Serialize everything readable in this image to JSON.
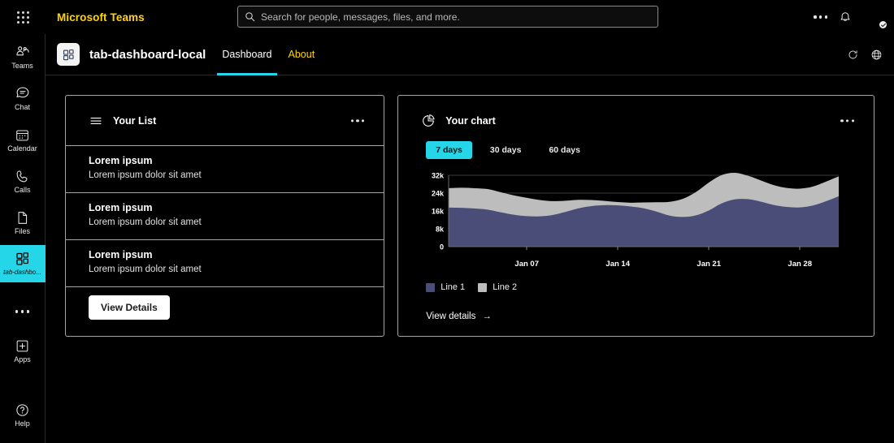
{
  "topbar": {
    "waffle_name": "app-launcher",
    "brand": "Microsoft Teams",
    "search_placeholder": "Search for people, messages, files, and more.",
    "more_label": "...",
    "bell_label": "Notifications"
  },
  "rail": {
    "items": [
      {
        "label": "Teams",
        "icon": "teams-icon",
        "active": false
      },
      {
        "label": "Chat",
        "icon": "chat-icon",
        "active": false
      },
      {
        "label": "Calendar",
        "icon": "calendar-icon",
        "active": false
      },
      {
        "label": "Calls",
        "icon": "calls-icon",
        "active": false
      },
      {
        "label": "Files",
        "icon": "files-icon",
        "active": false
      },
      {
        "label": "tab-dashbo...",
        "icon": "dashboard-app-icon",
        "active": true
      }
    ],
    "more_label": "...",
    "apps_label": "Apps",
    "help_label": "Help",
    "active_color": "#24d6e8"
  },
  "appheader": {
    "title": "tab-dashboard-local",
    "tabs": [
      {
        "label": "Dashboard",
        "active": true
      },
      {
        "label": "About",
        "active": false
      }
    ],
    "accent": "#24d6e8",
    "inactive_tab_color": "#ffd400",
    "refresh_label": "Refresh",
    "globe_label": "Open in browser"
  },
  "list_card": {
    "title": "Your List",
    "icon": "list-icon",
    "more_label": "...",
    "items": [
      {
        "title": "Lorem ipsum",
        "subtitle": "Lorem ipsum dolor sit amet"
      },
      {
        "title": "Lorem ipsum",
        "subtitle": "Lorem ipsum dolor sit amet"
      },
      {
        "title": "Lorem ipsum",
        "subtitle": "Lorem ipsum dolor sit amet"
      }
    ],
    "button_label": "View Details"
  },
  "chart_card": {
    "title": "Your chart",
    "icon": "pie-chart-icon",
    "more_label": "...",
    "ranges": [
      {
        "label": "7 days",
        "active": true
      },
      {
        "label": "30 days",
        "active": false
      },
      {
        "label": "60 days",
        "active": false
      }
    ],
    "view_details_label": "View details",
    "arrow_glyph": "→"
  },
  "chart_data": {
    "type": "area",
    "title": "Your chart",
    "xlabel": "",
    "ylabel": "",
    "ylim": [
      0,
      32000
    ],
    "yticks": [
      0,
      8000,
      16000,
      24000,
      32000
    ],
    "ytick_labels": [
      "0",
      "8k",
      "16k",
      "24k",
      "32k"
    ],
    "grid": true,
    "stacked": true,
    "legend_position": "bottom-left",
    "x": [
      "Jan 01",
      "Jan 02",
      "Jan 03",
      "Jan 04",
      "Jan 05",
      "Jan 06",
      "Jan 07",
      "Jan 08",
      "Jan 09",
      "Jan 10",
      "Jan 11",
      "Jan 12",
      "Jan 13",
      "Jan 14",
      "Jan 15",
      "Jan 16",
      "Jan 17",
      "Jan 18",
      "Jan 19",
      "Jan 20",
      "Jan 21",
      "Jan 22",
      "Jan 23",
      "Jan 24",
      "Jan 25",
      "Jan 26",
      "Jan 27",
      "Jan 28",
      "Jan 29",
      "Jan 30",
      "Jan 31"
    ],
    "xtick_labels": [
      "Jan 07",
      "Jan 14",
      "Jan 21",
      "Jan 28"
    ],
    "xtick_positions": [
      6,
      13,
      20,
      27
    ],
    "series": [
      {
        "name": "Line 1",
        "color": "#4a4d78",
        "values": [
          17500,
          17400,
          17100,
          16600,
          15400,
          14300,
          13700,
          13600,
          14200,
          15600,
          17200,
          18200,
          18600,
          18500,
          18000,
          17200,
          15700,
          13900,
          13300,
          14000,
          16200,
          19400,
          21200,
          21300,
          20200,
          18700,
          17800,
          17600,
          18400,
          20300,
          22600
        ]
      },
      {
        "name": "Line 2",
        "color": "#bdbdbd",
        "values": [
          8700,
          9000,
          9100,
          9200,
          9000,
          8700,
          8200,
          7300,
          6200,
          5000,
          3800,
          2700,
          1900,
          1500,
          1700,
          2600,
          4200,
          6200,
          8100,
          10400,
          12500,
          12700,
          11900,
          10500,
          9500,
          8900,
          8500,
          8400,
          8500,
          8800,
          8900
        ]
      }
    ]
  }
}
